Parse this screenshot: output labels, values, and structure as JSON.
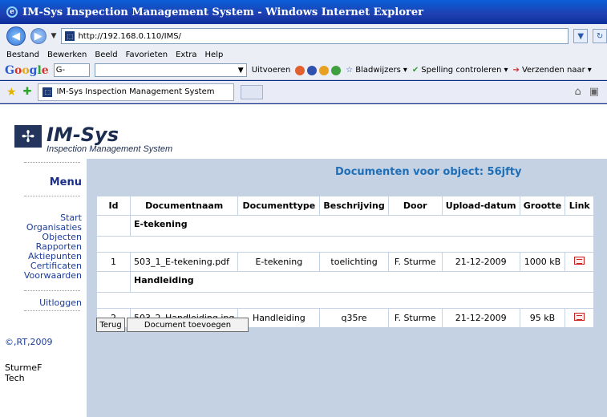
{
  "window": {
    "title": "IM-Sys Inspection Management System - Windows Internet Explorer"
  },
  "address": {
    "url": "http://192.168.0.110/IMS/"
  },
  "menubar": [
    "Bestand",
    "Bewerken",
    "Beeld",
    "Favorieten",
    "Extra",
    "Help"
  ],
  "toolbar": {
    "google_logo": "Google",
    "google_box": "G-",
    "search_action": "Uitvoeren",
    "bookmarks": "Bladwijzers",
    "spelling": "Spelling controleren",
    "send": "Verzenden naar"
  },
  "tabs": {
    "active": "IM-Sys Inspection Management System"
  },
  "logo": {
    "title": "IM-Sys",
    "subtitle": "Inspection Management System"
  },
  "sidebar": {
    "menu_title": "Menu",
    "links": [
      "Start",
      "Organisaties",
      "Objecten",
      "Rapporten",
      "Aktiepunten",
      "Certificaten",
      "Voorwaarden"
    ],
    "logout": "Uitloggen",
    "copyright": "©,RT,2009",
    "user_line1": "SturmeF",
    "user_line2": "Tech"
  },
  "main": {
    "heading": "Documenten voor object: 56jfty",
    "columns": [
      "Id",
      "Documentnaam",
      "Documenttype",
      "Beschrijving",
      "Door",
      "Upload-datum",
      "Grootte",
      "Link"
    ],
    "groups": [
      {
        "name": "E-tekening",
        "rows": [
          {
            "id": "1",
            "name": "503_1_E-tekening.pdf",
            "type": "E-tekening",
            "desc": "toelichting",
            "by": "F. Sturme",
            "date": "21-12-2009",
            "size": "1000 kB",
            "link_icon": "document-link-icon"
          }
        ]
      },
      {
        "name": "Handleiding",
        "rows": [
          {
            "id": "2",
            "name": "503_2_Handleiding.jpg",
            "type": "Handleiding",
            "desc": "q35re",
            "by": "F. Sturme",
            "date": "21-12-2009",
            "size": "95 kB",
            "link_icon": "document-link-icon"
          }
        ]
      }
    ],
    "back_button": "Terug",
    "add_button": "Document toevoegen"
  }
}
